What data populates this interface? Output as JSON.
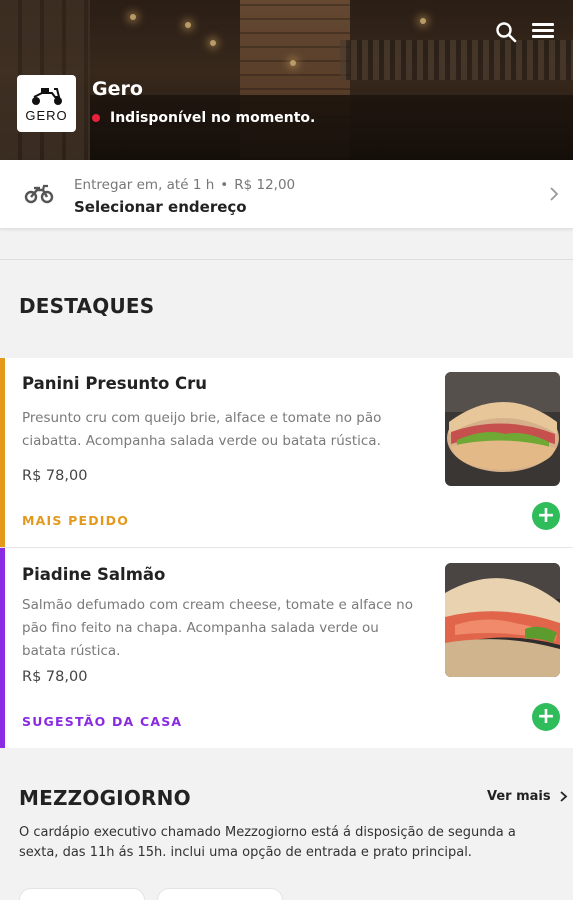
{
  "store": {
    "name": "Gero",
    "status": "Indisponível no momento.",
    "logo_text": "GERO"
  },
  "icons": {
    "search": "search-icon",
    "menu": "hamburger-menu-icon",
    "delivery": "motorcycle-icon",
    "chevron": "chevron-right-icon",
    "add": "plus-icon"
  },
  "delivery": {
    "eta": "Entregar em, até 1 h",
    "separator": "•",
    "fee": "R$ 12,00",
    "address_cta": "Selecionar endereço"
  },
  "highlights": {
    "title": "DESTAQUES",
    "products": [
      {
        "name": "Panini Presunto Cru",
        "description": "Presunto cru com queijo brie, alface e tomate no pão ciabatta. Acompanha salada verde ou batata rústica.",
        "price": "R$ 78,00",
        "tag": "MAIS PEDIDO",
        "tag_color": "#e39a1c",
        "add_label": "+"
      },
      {
        "name": "Piadine Salmão",
        "description": "Salmão defumado com cream cheese, tomate e alface no pão fino feito na chapa. Acompanha salada verde ou batata rústica.",
        "price": "R$ 78,00",
        "tag": "SUGESTÃO DA CASA",
        "tag_color": "#8a2be2",
        "add_label": "+"
      }
    ]
  },
  "mezzogiorno": {
    "title": "MEZZOGIORNO",
    "see_more": "Ver mais",
    "description": "O cardápio executivo chamado Mezzogiorno está á disposição de segunda a sexta, das 11h ás 15h. inclui uma opção de entrada e prato principal."
  },
  "colors": {
    "accent_green": "#2fbd5c",
    "status_red": "#e8223d"
  }
}
